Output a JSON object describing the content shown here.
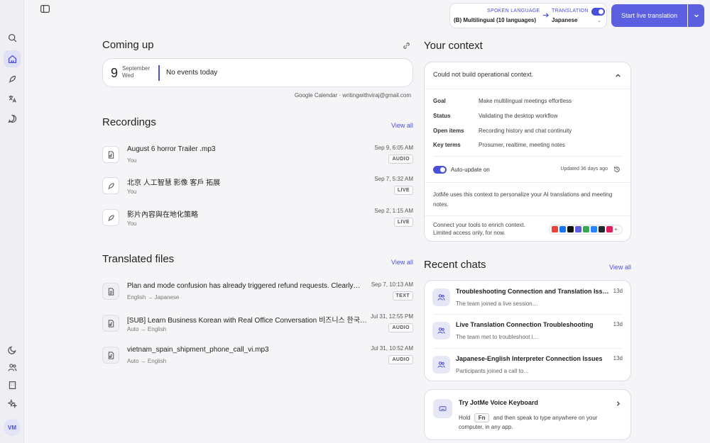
{
  "sidebar": {
    "avatar_initials": "VM"
  },
  "topbar": {
    "spoken_label": "SPOKEN LANGUAGE",
    "spoken_value": "(B) Multilingual (10 languages)",
    "translation_label": "TRANSLATION",
    "translation_value": "Japanese",
    "start_button": "Start live translation"
  },
  "coming_up": {
    "title": "Coming up",
    "day": "9",
    "month": "September",
    "weekday": "Wed",
    "event_text": "No events today",
    "source": "Google Calendar · writingwithviraj@gmail.com"
  },
  "recordings": {
    "title": "Recordings",
    "view_all": "View all",
    "items": [
      {
        "title": "August 6 horror Trailer .mp3",
        "sub": "You",
        "date": "Sep 9, 6:05 AM",
        "badge": "AUDIO"
      },
      {
        "title": "北京 人工智慧 影像 客戶 拓展",
        "sub": "You",
        "date": "Sep 7, 5:32 AM",
        "badge": "LIVE"
      },
      {
        "title": "影片內容與在地化策略",
        "sub": "You",
        "date": "Sep 2, 1:15 AM",
        "badge": "LIVE"
      }
    ]
  },
  "translated": {
    "title": "Translated files",
    "view_all": "View all",
    "items": [
      {
        "title": "Plan and mode confusion has already triggered refund requests. Clearly…",
        "sub": "English → Japanese",
        "date": "Sep 7, 10:13 AM",
        "badge": "TEXT"
      },
      {
        "title": "[SUB] Learn Business Korean with Real Office Conversation 비즈니스 한국…",
        "sub": "Auto → English",
        "date": "Jul 31, 12:55 PM",
        "badge": "AUDIO"
      },
      {
        "title": "vietnam_spain_shipment_phone_call_vi.mp3",
        "sub": "Auto → English",
        "date": "Jul 31, 10:52 AM",
        "badge": "AUDIO"
      }
    ]
  },
  "context": {
    "title": "Your context",
    "status_message": "Could not build operational context.",
    "fields": [
      {
        "key": "Goal",
        "value": "Make multilingual meetings effortless"
      },
      {
        "key": "Status",
        "value": "Validating the desktop workflow"
      },
      {
        "key": "Open items",
        "value": "Recording history and chat continuity"
      },
      {
        "key": "Key terms",
        "value": "Prosumer, realtime, meeting notes"
      }
    ],
    "auto_update_label": "Auto-update on",
    "updated_text": "Updated 36 days ago",
    "description": "JotMe uses this context to personalize your AI translations and meeting notes.",
    "connect_text_1": "Connect your tools to enrich context.",
    "connect_text_2": "Limited access only, for now."
  },
  "recent_chats": {
    "title": "Recent chats",
    "view_all": "View all",
    "items": [
      {
        "title": "Troubleshooting Connection and Translation Issu…",
        "sub": "The team joined a live session…",
        "age": "13d"
      },
      {
        "title": "Live Translation Connection Troubleshooting",
        "sub": "The team met to troubleshoot i…",
        "age": "13d"
      },
      {
        "title": "Japanese-English Interpreter Connection Issues",
        "sub": "Participants joined a call to…",
        "age": "13d"
      }
    ]
  },
  "voice_keyboard": {
    "title": "Try JotMe Voice Keyboard",
    "hold": "Hold",
    "key": "Fn",
    "rest_1": "and then speak to type anywhere on your",
    "rest_2": "computer, in any app."
  },
  "colors": {
    "accent": "#5b5fe0"
  }
}
